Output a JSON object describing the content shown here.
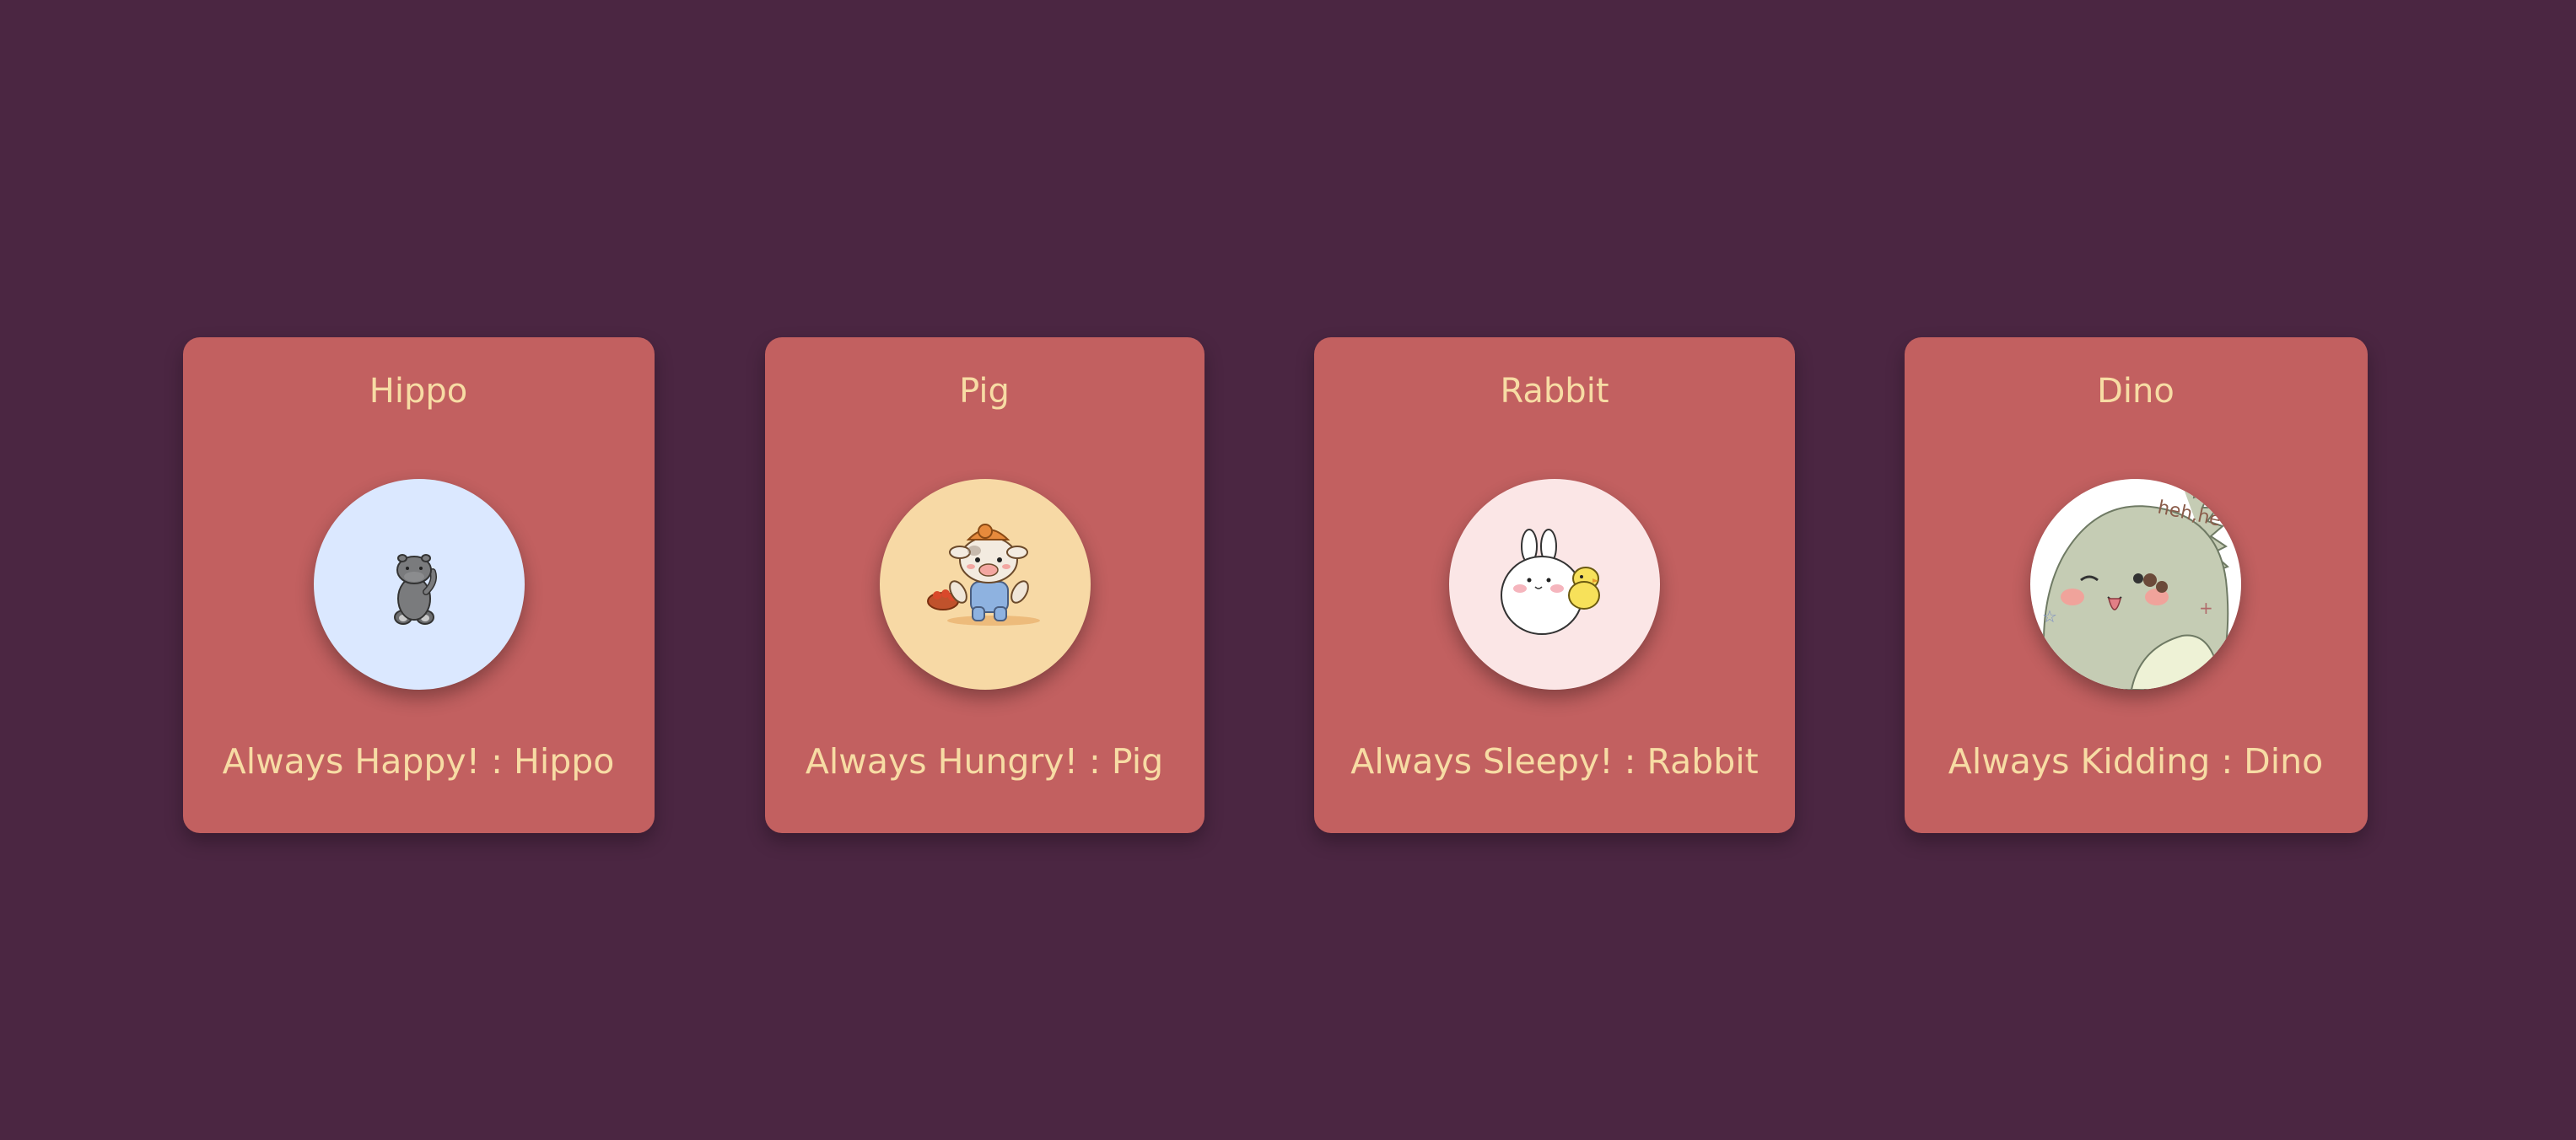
{
  "colors": {
    "background": "#4b2642",
    "card": "#c26060",
    "text": "#f7dca4"
  },
  "cards": [
    {
      "title": "Hippo",
      "caption": "Always Happy! : Hippo",
      "avatar_icon": "hippo-icon",
      "avatar_bg": "#dbe8ff"
    },
    {
      "title": "Pig",
      "caption": "Always Hungry! : Pig",
      "avatar_icon": "pig-icon",
      "avatar_bg": "#f7d9a5"
    },
    {
      "title": "Rabbit",
      "caption": "Always Sleepy! : Rabbit",
      "avatar_icon": "rabbit-icon",
      "avatar_bg": "#fbe6e6"
    },
    {
      "title": "Dino",
      "caption": "Always Kidding : Dino",
      "avatar_icon": "dino-icon",
      "avatar_bg": "#ffffff"
    }
  ]
}
